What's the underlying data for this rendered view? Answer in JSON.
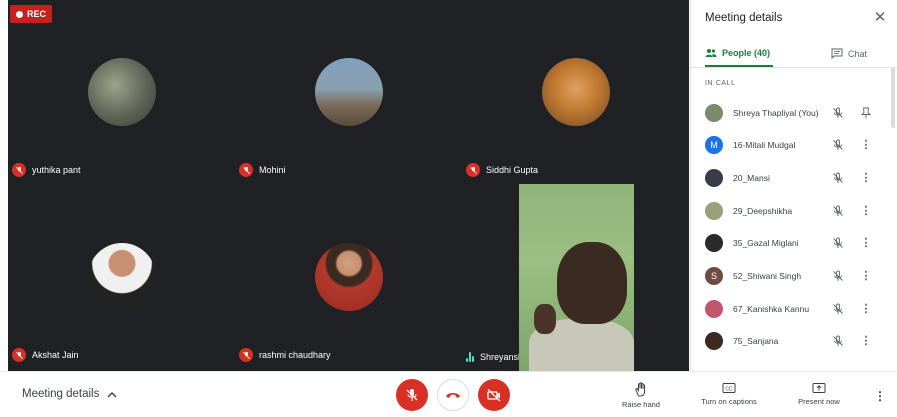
{
  "recording": {
    "label": "REC"
  },
  "participants_tiles": [
    {
      "name": "yuthika pant",
      "muted": true,
      "avatar_bg": "#6a6e62"
    },
    {
      "name": "Mohini",
      "muted": true,
      "avatar_bg": "#8a9aa8"
    },
    {
      "name": "Siddhi Gupta",
      "muted": true,
      "avatar_bg": "#c89048"
    },
    {
      "name": "Akshat Jain",
      "muted": true,
      "avatar_bg": "#e8e8e8"
    },
    {
      "name": "rashmi chaudhary",
      "muted": true,
      "avatar_bg": "#b33a2c"
    },
    {
      "name": "Shreyansh Dubey",
      "speaking": true
    }
  ],
  "panel": {
    "title": "Meeting details",
    "tabs": {
      "people": "People (40)",
      "chat": "Chat"
    },
    "section": "IN CALL",
    "people": [
      {
        "name": "Shreya Thapliyal (You)",
        "avatar_bg": "#7a8a6a",
        "initial": ""
      },
      {
        "name": "16-Mitali Mudgal",
        "avatar_bg": "#1a73e8",
        "initial": "M"
      },
      {
        "name": "20_Mansi",
        "avatar_bg": "#3a3a4a",
        "initial": ""
      },
      {
        "name": "29_Deepshikha",
        "avatar_bg": "#9aa07a",
        "initial": ""
      },
      {
        "name": "35_Gazal Miglani",
        "avatar_bg": "#2a2a2a",
        "initial": ""
      },
      {
        "name": "52_Shiwani Singh",
        "avatar_bg": "#6d4c41",
        "initial": "S"
      },
      {
        "name": "67_Kanishka Kannu",
        "avatar_bg": "#c2566a",
        "initial": ""
      },
      {
        "name": "75_Sanjana",
        "avatar_bg": "#3a2a22",
        "initial": ""
      }
    ]
  },
  "bottom_bar": {
    "meeting_details": "Meeting details",
    "raise_hand": "Raise hand",
    "captions": "Turn on captions",
    "present": "Present now"
  },
  "colors": {
    "accent": "#188038",
    "danger": "#d93025",
    "grid_bg": "#202124"
  }
}
